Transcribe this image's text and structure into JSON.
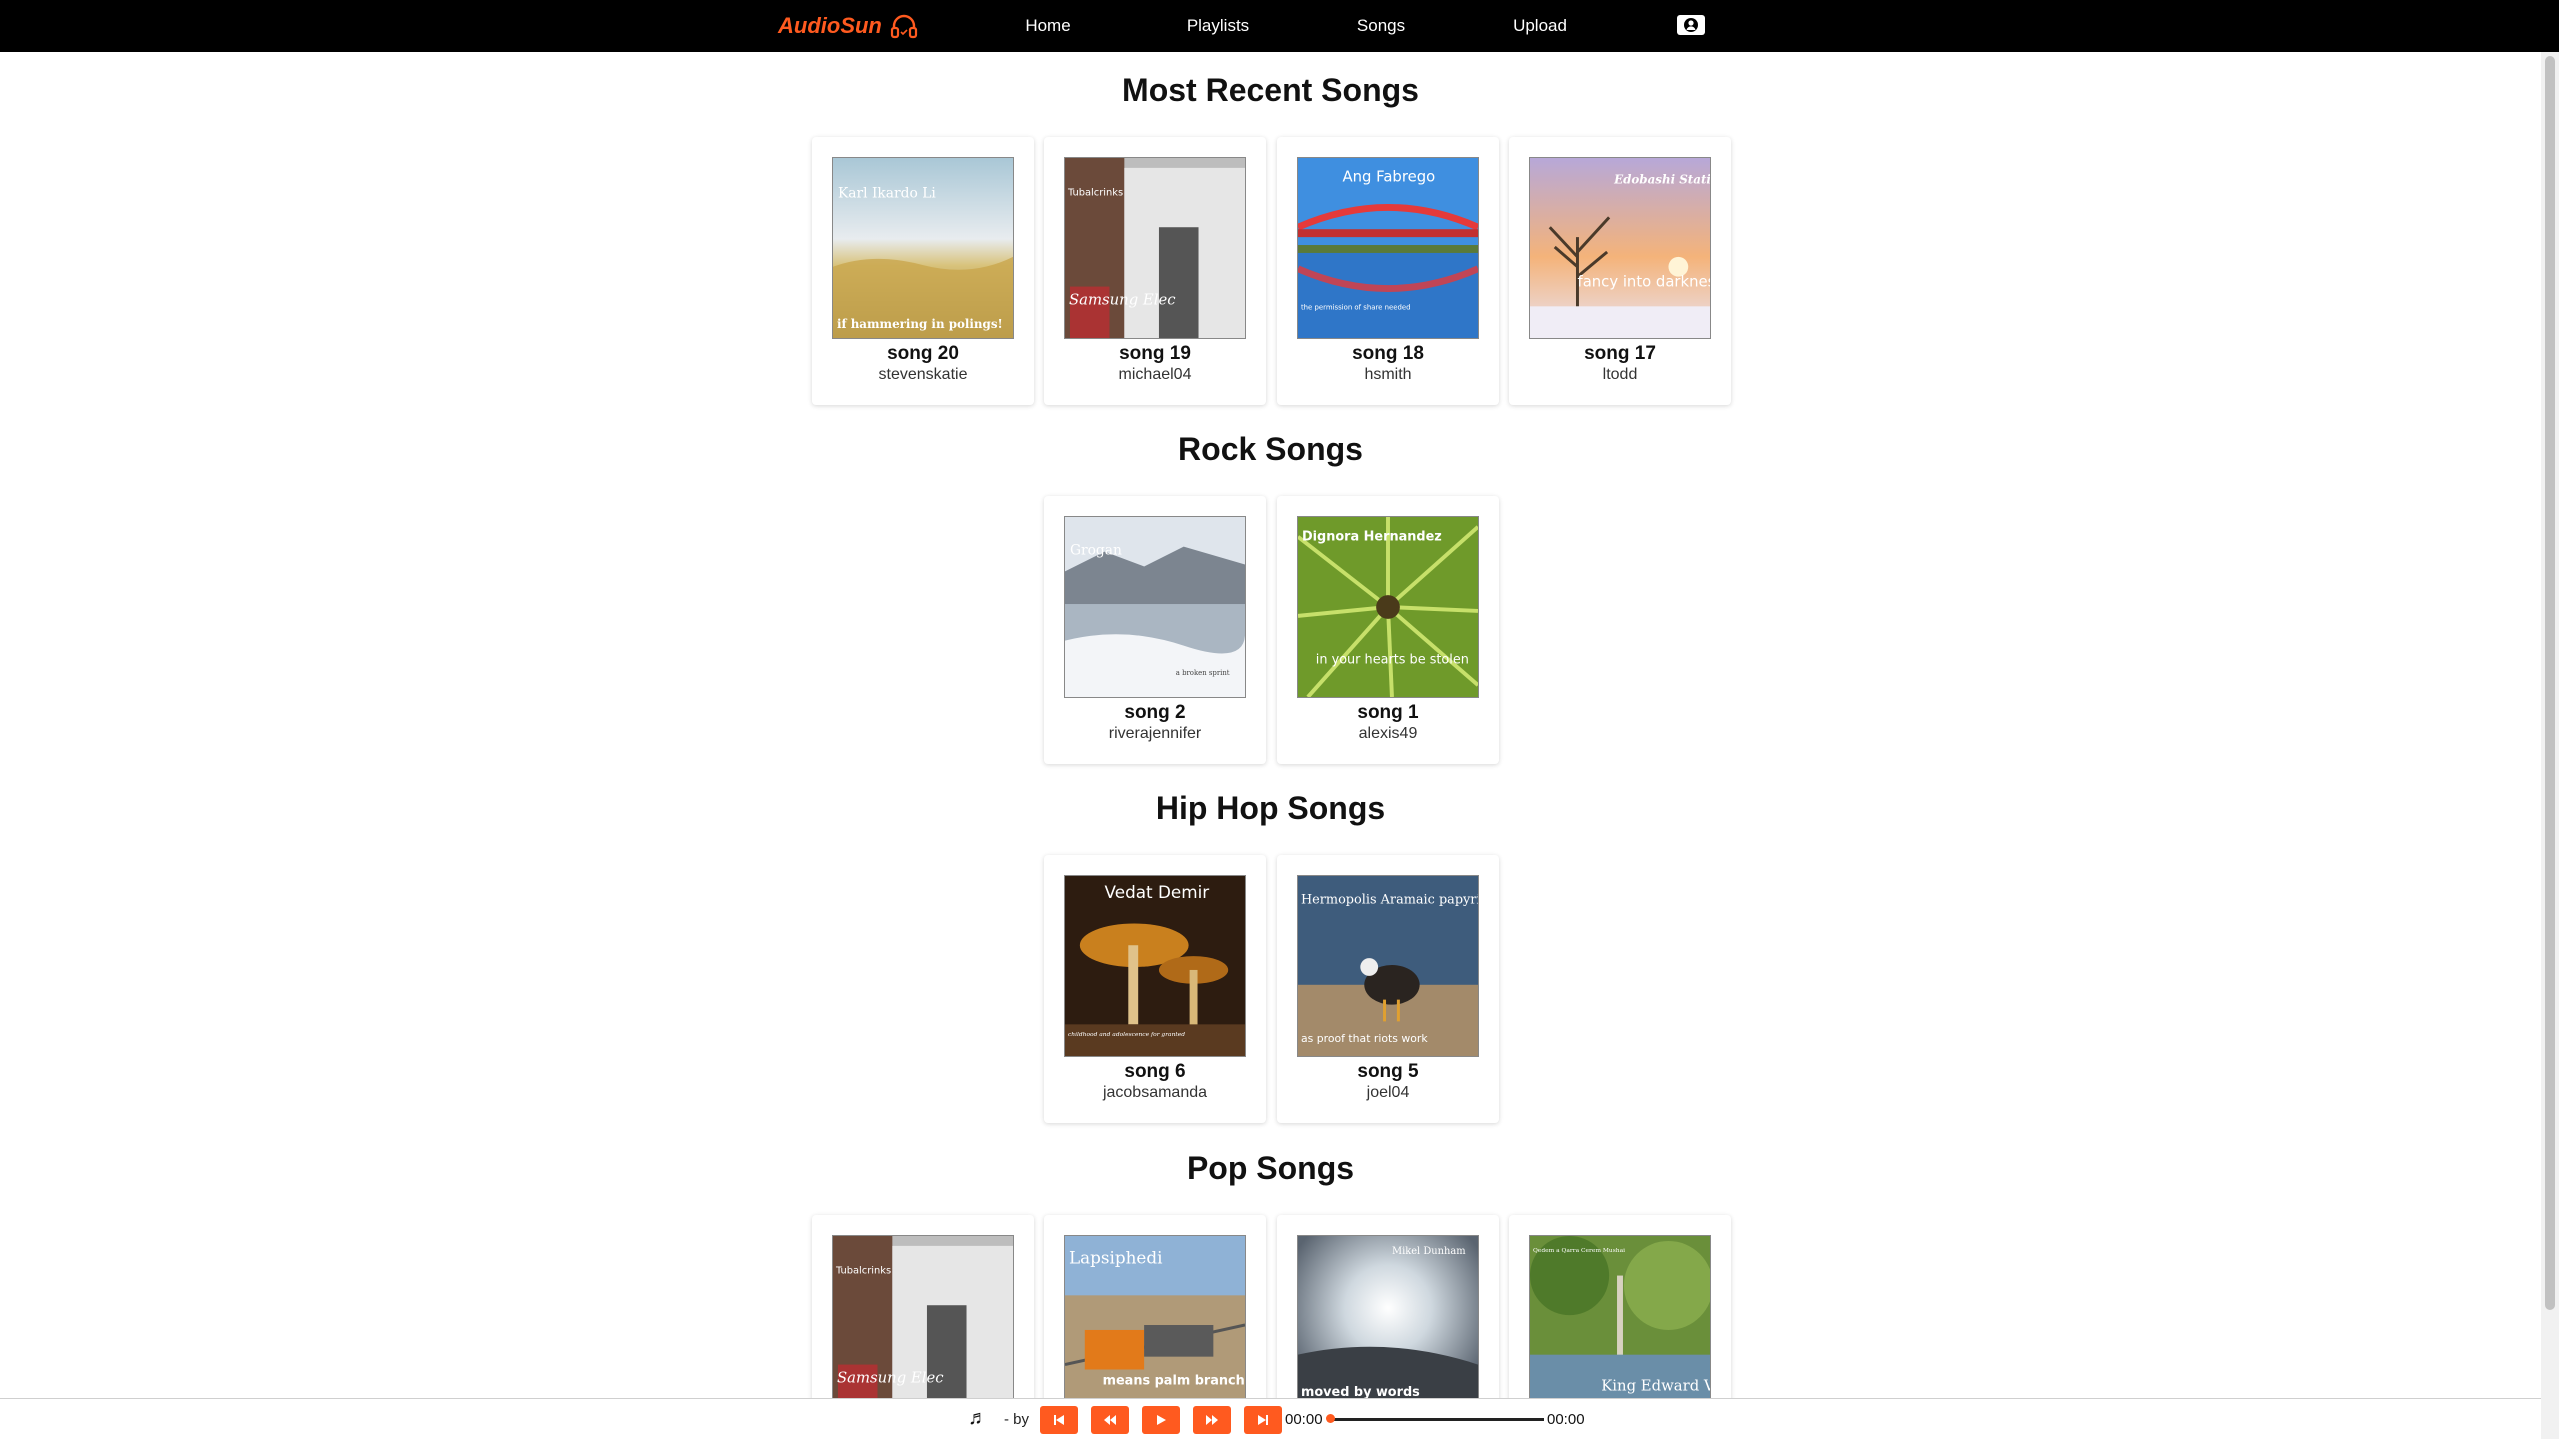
{
  "nav": {
    "brand": "AudioSun",
    "links": [
      "Home",
      "Playlists",
      "Songs",
      "Upload"
    ]
  },
  "sections": [
    {
      "title": "Most Recent Songs",
      "cards": [
        {
          "title": "song 20",
          "artist": "stevenskatie",
          "cover_top": "Karl Ikardo Li",
          "cover_bottom": "if hammering in polings!"
        },
        {
          "title": "song 19",
          "artist": "michael04",
          "cover_top": "Tubalcrinks",
          "cover_bottom": "Samsung Elec"
        },
        {
          "title": "song 18",
          "artist": "hsmith",
          "cover_top": "Ang Fabrego",
          "cover_bottom": "the permission of share needed"
        },
        {
          "title": "song 17",
          "artist": "ltodd",
          "cover_top": "Edobashi Station",
          "cover_bottom": "fancy into darkness"
        }
      ]
    },
    {
      "title": "Rock Songs",
      "cards": [
        {
          "title": "song 2",
          "artist": "riverajennifer",
          "cover_top": "Grogan",
          "cover_bottom": "a broken sprint"
        },
        {
          "title": "song 1",
          "artist": "alexis49",
          "cover_top": "Dignora Hernandez",
          "cover_bottom": "in your hearts be stolen"
        }
      ]
    },
    {
      "title": "Hip Hop Songs",
      "cards": [
        {
          "title": "song 6",
          "artist": "jacobsamanda",
          "cover_top": "Vedat Demir",
          "cover_bottom": "childhood and adolescence for granted"
        },
        {
          "title": "song 5",
          "artist": "joel04",
          "cover_top": "Hermopolis Aramaic papyri",
          "cover_bottom": "as proof that riots work"
        }
      ]
    },
    {
      "title": "Pop Songs",
      "cards": [
        {
          "title": "",
          "artist": "",
          "cover_top": "Tubalcrinks",
          "cover_bottom": "Samsung Elec"
        },
        {
          "title": "",
          "artist": "",
          "cover_top": "Lapsiphedi",
          "cover_bottom": "means palm branch"
        },
        {
          "title": "",
          "artist": "",
          "cover_top": "Mikel Dunham",
          "cover_bottom": "moved by words"
        },
        {
          "title": "",
          "artist": "",
          "cover_top": "Qedem a Qarra Cerem Mushai",
          "cover_bottom": "King Edward VII"
        }
      ]
    }
  ],
  "player": {
    "meta": "- by",
    "current_time": "00:00",
    "total_time": "00:00",
    "progress": 0
  },
  "colors": {
    "accent": "#ff5a1f",
    "nav_bg": "#000000"
  },
  "icons": [
    "headphones-icon",
    "account-icon",
    "music-note-icon",
    "skip-start-icon",
    "rewind-icon",
    "play-icon",
    "fast-forward-icon",
    "skip-end-icon"
  ]
}
